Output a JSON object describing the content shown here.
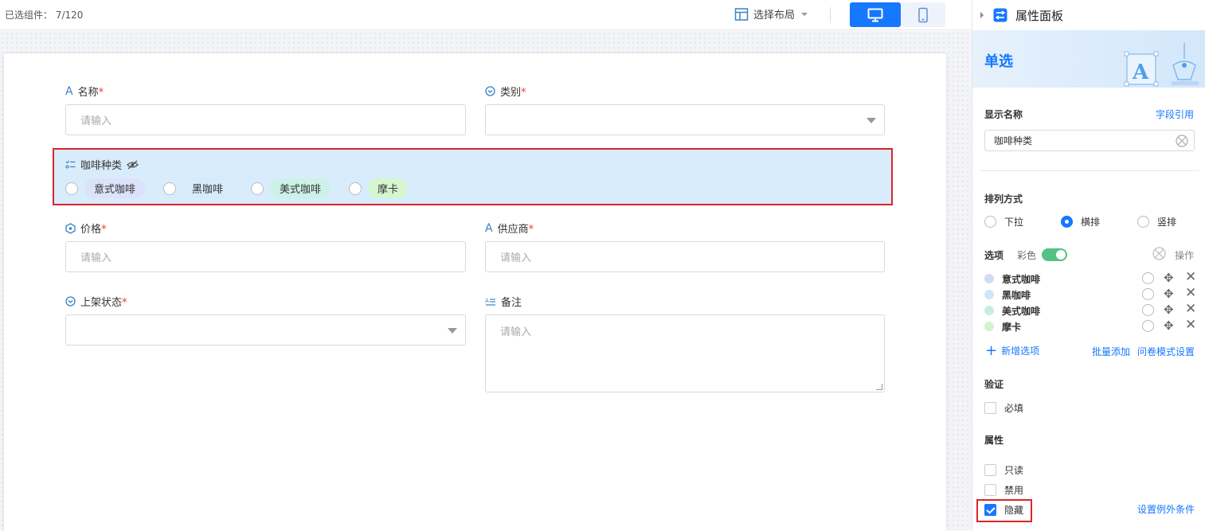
{
  "topbar": {
    "selected_count": "已选组件：  7/120",
    "layout_label": "选择布局"
  },
  "form": {
    "name": {
      "label": "名称",
      "required": "*",
      "placeholder": "请输入"
    },
    "category": {
      "label": "类别",
      "required": "*"
    },
    "coffee": {
      "label": "咖啡种类",
      "options": [
        {
          "label": "意式咖啡",
          "color": "#dde2fb"
        },
        {
          "label": "黑咖啡",
          "color": "#d6ecfb"
        },
        {
          "label": "美式咖啡",
          "color": "#cdf1e6"
        },
        {
          "label": "摩卡",
          "color": "#d6f6cf"
        }
      ]
    },
    "price": {
      "label": "价格",
      "required": "*",
      "placeholder": "请输入"
    },
    "supplier": {
      "label": "供应商",
      "required": "*",
      "placeholder": "请输入"
    },
    "status": {
      "label": "上架状态",
      "required": "*"
    },
    "note": {
      "label": "备注",
      "placeholder": "请输入"
    }
  },
  "panel": {
    "title": "属性面板",
    "banner_title": "单选",
    "display_name": {
      "label": "显示名称",
      "link": "字段引用",
      "value": "咖啡种类"
    },
    "arrange": {
      "label": "排列方式",
      "options": [
        "下拉",
        "横排",
        "竖排"
      ],
      "selected": "横排"
    },
    "options_section": {
      "label": "选项",
      "color_label": "彩色",
      "action_label": "操作",
      "items": [
        {
          "label": "意式咖啡",
          "color": "#cfdcf7"
        },
        {
          "label": "黑咖啡",
          "color": "#cfe6fa"
        },
        {
          "label": "美式咖啡",
          "color": "#c8eee0"
        },
        {
          "label": "摩卡",
          "color": "#d1f3cf"
        }
      ],
      "add_label": "新增选项",
      "batch_add": "批量添加",
      "survey_mode": "问卷模式设置"
    },
    "validation": {
      "label": "验证",
      "required_label": "必填"
    },
    "attributes": {
      "label": "属性",
      "readonly": "只读",
      "disabled": "禁用",
      "hidden": "隐藏",
      "exception_link": "设置例外条件"
    }
  },
  "colors": {
    "accent": "#1677ff",
    "highlight_border": "#d9262c",
    "toggle_on": "#52c286"
  }
}
